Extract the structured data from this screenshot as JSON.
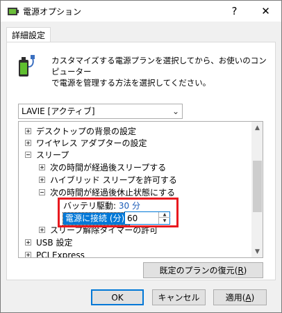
{
  "window": {
    "title": "電源オプション",
    "help": "?",
    "close": "✕"
  },
  "tab": {
    "label": "詳細設定"
  },
  "description": {
    "line1": "カスタマイズする電源プランを選択してから、お使いのコンピューター",
    "line2": "で電源を管理する方法を選択してください。"
  },
  "plan_select": {
    "value": "LAVIE [アクティブ]"
  },
  "tree": {
    "items": [
      {
        "label": "デスクトップの背景の設定",
        "state": "plus"
      },
      {
        "label": "ワイヤレス アダプターの設定",
        "state": "plus"
      },
      {
        "label": "スリープ",
        "state": "minus"
      },
      {
        "label": "次の時間が経過後スリープする",
        "state": "plus"
      },
      {
        "label": "ハイブリッド スリープを許可する",
        "state": "plus"
      },
      {
        "label": "次の時間が経過後休止状態にする",
        "state": "minus"
      },
      {
        "label": "スリープ解除タイマーの許可",
        "state": "plus"
      },
      {
        "label": "USB 設定",
        "state": "plus"
      },
      {
        "label": "PCI Express",
        "state": "plus"
      }
    ],
    "battery_label": "バッテリ駆動:",
    "battery_value": "30 分",
    "ac_label": "電源に接続 (分):",
    "ac_value": "60"
  },
  "buttons": {
    "restore": "既定のプランの復元(",
    "restore_key": "R",
    "restore_end": ")",
    "ok": "OK",
    "cancel": "キャンセル",
    "apply": "適用(",
    "apply_key": "A",
    "apply_end": ")"
  },
  "colors": {
    "accent": "#0078d7",
    "highlight_border": "#e8191f",
    "battery_value": "#1a5bb7"
  }
}
